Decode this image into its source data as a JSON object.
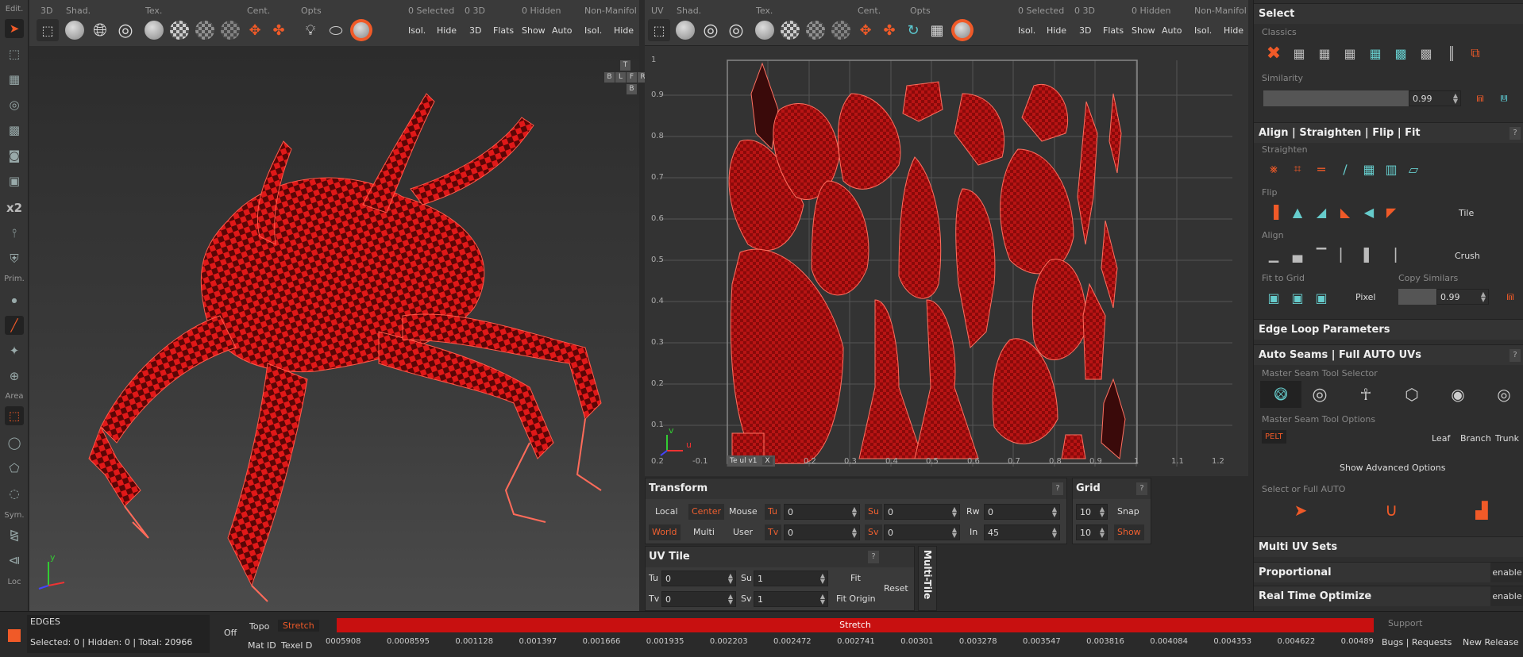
{
  "left_toolbar": {
    "edit_label": "Edit.",
    "x2_label": "x2",
    "prim_label": "Prim.",
    "area_label": "Area",
    "sym_label": "Sym.",
    "loc_label": "Loc"
  },
  "view3d": {
    "labels": [
      "3D",
      "Shad.",
      "Tex.",
      "Cent.",
      "Opts"
    ],
    "selected": "0 Selected",
    "count3d": "0 3D",
    "hidden": "0 Hidden",
    "nonmanifold": "Non-Manifol",
    "buttons": [
      "Isol.",
      "Hide",
      "3D",
      "Flats",
      "Show",
      "Auto",
      "Isol.",
      "Hide"
    ],
    "cube": {
      "top": "T",
      "row": [
        "B",
        "L",
        "F",
        "R"
      ],
      "bottom": "B"
    },
    "axis_y": "y"
  },
  "viewuv": {
    "labels": [
      "UV",
      "Shad.",
      "Tex.",
      "Cent.",
      "Opts"
    ],
    "selected": "0 Selected",
    "count3d": "0 3D",
    "hidden": "0 Hidden",
    "nonmanifold": "Non-Manifol",
    "buttons": [
      "Isol.",
      "Hide",
      "3D",
      "Flats",
      "Show",
      "Auto",
      "Isol.",
      "Hide"
    ],
    "y_ticks": [
      "1",
      "0.9",
      "0.8",
      "0.7",
      "0.6",
      "0.5",
      "0.4",
      "0.3",
      "0.2",
      "0.1"
    ],
    "x_ticks": [
      "0.2",
      "0.3",
      "0.4",
      "0.5",
      "0.6",
      "0.7",
      "0.8",
      "0.9",
      "1",
      "1.1",
      "1.2"
    ],
    "origin_x": "-0.1",
    "origin_y": "0.2",
    "axis_v": "v",
    "axis_u": "u",
    "tile_label": "Te ul v1",
    "tile_close": "X"
  },
  "transform": {
    "title": "Transform",
    "help": "?",
    "row1": [
      "Local",
      "Center",
      "Mouse"
    ],
    "row2": [
      "World",
      "Multi",
      "User"
    ],
    "tu": "Tu",
    "tu_val": "0",
    "su": "Su",
    "su_val": "0",
    "rw": "Rw",
    "rw_val": "0",
    "tv": "Tv",
    "tv_val": "0",
    "sv": "Sv",
    "sv_val": "0",
    "in": "In",
    "in_val": "45"
  },
  "grid": {
    "title": "Grid",
    "help": "?",
    "v1": "10",
    "v2": "10",
    "snap": "Snap",
    "show": "Show"
  },
  "uvtile": {
    "title": "UV Tile",
    "help": "?",
    "tu": "Tu",
    "tu_val": "0",
    "su": "Su",
    "su_val": "1",
    "tv": "Tv",
    "tv_val": "0",
    "sv": "Sv",
    "sv_val": "1",
    "fit": "Fit",
    "fit_origin": "Fit Origin",
    "reset": "Reset",
    "multi_tile": "Multi-Tile"
  },
  "right": {
    "select": {
      "title": "Select",
      "classics": "Classics",
      "similarity": "Similarity",
      "similarity_val": "0.99"
    },
    "align": {
      "title": "Align | Straighten | Flip | Fit",
      "help": "?",
      "straighten": "Straighten",
      "flip": "Flip",
      "tile": "Tile",
      "align": "Align",
      "crush": "Crush",
      "fit_to_grid": "Fit to Grid",
      "copy_similars": "Copy Similars",
      "pixel": "Pixel",
      "copy_val": "0.99"
    },
    "edge_loop": "Edge Loop Parameters",
    "auto_seams": {
      "title": "Auto Seams | Full AUTO UVs",
      "help": "?",
      "master_selector": "Master Seam Tool Selector",
      "master_options": "Master Seam Tool Options",
      "pelt": "PELT",
      "leaf": "Leaf",
      "branch": "Branch",
      "trunk": "Trunk",
      "show_advanced": "Show Advanced Options",
      "select_or_full": "Select or Full AUTO"
    },
    "multi_uv": "Multi UV Sets",
    "proportional": "Proportional",
    "proportional_btn": "enable",
    "realtime": "Real Time Optimize",
    "realtime_btn": "enable"
  },
  "status": {
    "mode": "EDGES",
    "info": "Selected: 0 | Hidden: 0 | Total: 20966",
    "off": "Off",
    "topo": "Topo",
    "stretch": "Stretch",
    "mat_id": "Mat ID",
    "texel_d": "Texel D",
    "bar_label": "Stretch",
    "scale": [
      "0005908",
      "0.0008595",
      "0.001128",
      "0.001397",
      "0.001666",
      "0.001935",
      "0.002203",
      "0.002472",
      "0.002741",
      "0.00301",
      "0.003278",
      "0.003547",
      "0.003816",
      "0.004084",
      "0.004353",
      "0.004622",
      "0.00489"
    ],
    "support": "Support",
    "bugs": "Bugs | Requests",
    "new_release": "New Release"
  },
  "colors": {
    "accent": "#f05a28",
    "stretch_bar": "#c81010",
    "icon_teal": "#5cc8d0"
  }
}
